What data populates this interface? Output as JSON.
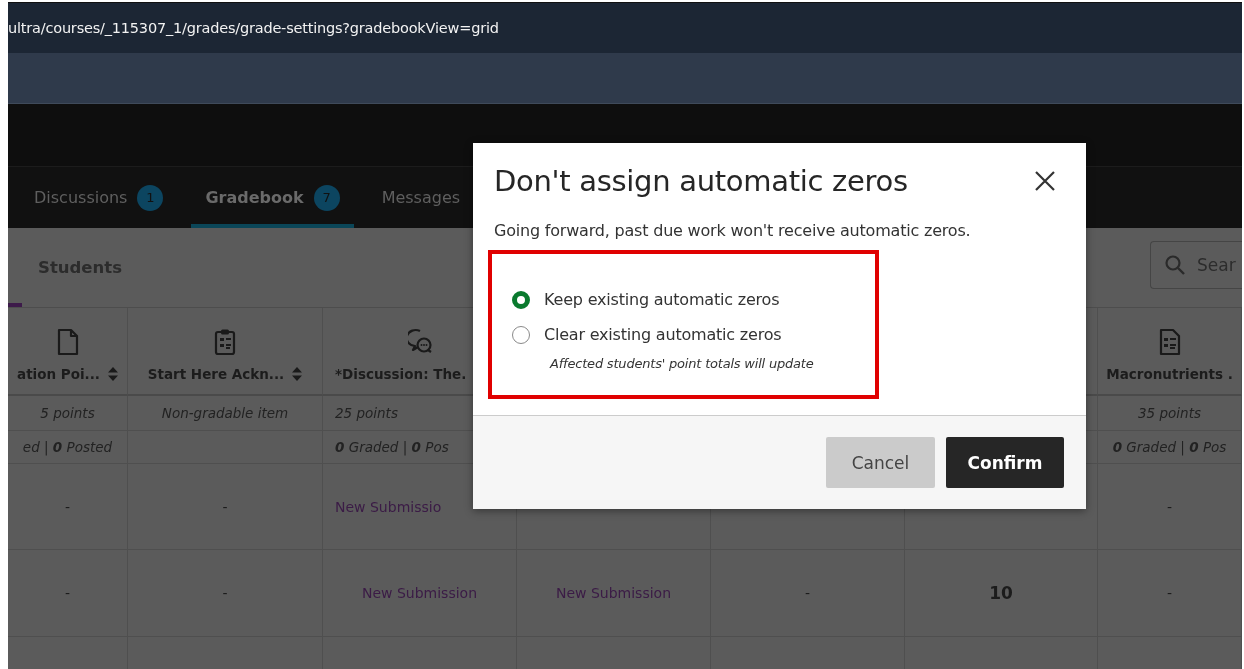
{
  "address_bar": {
    "url": "ultra/courses/_115307_1/grades/grade-settings?gradebookView=grid"
  },
  "course_tabs": [
    {
      "label": "Discussions",
      "badge": "1",
      "selected": false
    },
    {
      "label": "Gradebook",
      "badge": "7",
      "selected": true
    },
    {
      "label": "Messages",
      "selected": false
    }
  ],
  "sub_tabs": [
    {
      "label": "Students"
    }
  ],
  "search": {
    "placeholder": "Sear"
  },
  "table": {
    "columns": [
      {
        "kind": "document",
        "title": "ation Poi...",
        "sortable": true,
        "points": "5 points",
        "graded": "ed | **0** Posted"
      },
      {
        "kind": "clipboard",
        "title": "Start Here Ackn...",
        "sortable": true,
        "points": "Non-gradable item"
      },
      {
        "kind": "discussion",
        "title": "*Discussion: The.",
        "cut": true,
        "points": "25 points",
        "graded": "**0** Graded | **0** Pos"
      },
      null,
      null,
      null,
      {
        "kind": "form",
        "title": "Macronutrients .",
        "points": "35 points",
        "graded": "**0** Graded | **0** Pos"
      }
    ],
    "rows": [
      [
        {
          "text": "-"
        },
        {
          "text": "-"
        },
        {
          "text": "New Submissio",
          "kind": "link",
          "cut": true
        },
        null,
        null,
        null,
        {
          "text": "-"
        }
      ],
      [
        {
          "text": "-"
        },
        {
          "text": "-"
        },
        {
          "text": "New Submission",
          "kind": "link"
        },
        {
          "text": "New Submission",
          "kind": "link"
        },
        {
          "text": "-"
        },
        {
          "text": "10",
          "kind": "grade"
        },
        {
          "text": "-"
        }
      ],
      [
        null,
        null,
        null,
        null,
        null,
        null,
        null
      ]
    ]
  },
  "dialog": {
    "title": "Don't assign automatic zeros",
    "description": "Going forward, past due work won't receive automatic zeros.",
    "options": [
      {
        "label": "Keep existing automatic zeros",
        "selected": true
      },
      {
        "label": "Clear existing automatic zeros",
        "selected": false,
        "note": "Affected students' point totals will update"
      }
    ],
    "buttons": [
      {
        "label": "Cancel",
        "kind": "secondary"
      },
      {
        "label": "Confirm",
        "kind": "primary"
      }
    ]
  }
}
